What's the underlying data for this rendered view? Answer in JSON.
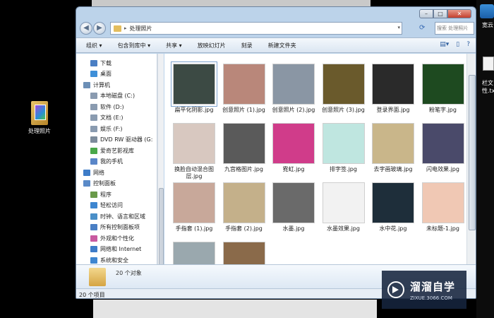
{
  "desktop": {
    "icon_label": "处理照片",
    "edge_labels": [
      "宽云",
      "栏文",
      "性.tx"
    ]
  },
  "window": {
    "address": {
      "folder_name": "处理照片",
      "separator": "▸"
    },
    "search_placeholder": "搜索 处理照片",
    "toolbar": [
      "组织 ▾",
      "包含到库中 ▾",
      "共享 ▾",
      "放映幻灯片",
      "刻录",
      "新建文件夹"
    ],
    "nav_items": [
      {
        "label": "下载",
        "color": "#4a7fc4",
        "indent": 2
      },
      {
        "label": "桌面",
        "color": "#3e8fd8",
        "indent": 2
      },
      {
        "label": "计算机",
        "color": "#6c8fb6",
        "indent": 1
      },
      {
        "label": "本地磁盘 (C:)",
        "color": "#8a9bb0",
        "indent": 2
      },
      {
        "label": "软件 (D:)",
        "color": "#8a9bb0",
        "indent": 2
      },
      {
        "label": "文档 (E:)",
        "color": "#8a9bb0",
        "indent": 2
      },
      {
        "label": "娱乐 (F:)",
        "color": "#8a9bb0",
        "indent": 2
      },
      {
        "label": "DVD RW 驱动器 (G:",
        "color": "#7d8c9c",
        "indent": 2
      },
      {
        "label": "爱奇艺影视库",
        "color": "#4aa84a",
        "indent": 2
      },
      {
        "label": "我的手机",
        "color": "#5a86c8",
        "indent": 2
      },
      {
        "label": "网络",
        "color": "#3e7cc8",
        "indent": 1
      },
      {
        "label": "控制面板",
        "color": "#5a8ac8",
        "indent": 1
      },
      {
        "label": "程序",
        "color": "#6a9a4a",
        "indent": 2
      },
      {
        "label": "轻松访问",
        "color": "#3e86d0",
        "indent": 2
      },
      {
        "label": "时钟、语言和区域",
        "color": "#4a8fc8",
        "indent": 2
      },
      {
        "label": "所有控制面板项",
        "color": "#4a7fc4",
        "indent": 2
      },
      {
        "label": "外观和个性化",
        "color": "#c85aa0",
        "indent": 2
      },
      {
        "label": "网络和 Internet",
        "color": "#3e7cc8",
        "indent": 2
      },
      {
        "label": "系统和安全",
        "color": "#3e86d0",
        "indent": 2
      }
    ],
    "files": [
      {
        "name": "扁平化阴影.jpg",
        "bg": "#3c4a44",
        "selected": true
      },
      {
        "name": "创意照片 (1).jpg",
        "bg": "#b9877a"
      },
      {
        "name": "创意照片 (2).jpg",
        "bg": "#8a96a4"
      },
      {
        "name": "创意照片 (3).jpg",
        "bg": "#6a5a2c"
      },
      {
        "name": "登录界面.jpg",
        "bg": "#2a2a2a"
      },
      {
        "name": "粉笔字.jpg",
        "bg": "#1e4a20"
      },
      {
        "name": "换脸自动混合图层.jpg",
        "bg": "#d8c8c0"
      },
      {
        "name": "九宫格图片.jpg",
        "bg": "#5a5a5a"
      },
      {
        "name": "霓虹.jpg",
        "bg": "#d03c8a"
      },
      {
        "name": "排字签.jpg",
        "bg": "#bfe6e0"
      },
      {
        "name": "去字画玻璃.jpg",
        "bg": "#c9b68a"
      },
      {
        "name": "闪电效果.jpg",
        "bg": "#4a4a6a"
      },
      {
        "name": "手指套 (1).jpg",
        "bg": "#c8a89a"
      },
      {
        "name": "手指套 (2).jpg",
        "bg": "#c4b08a"
      },
      {
        "name": "水墨.jpg",
        "bg": "#6a6a6a"
      },
      {
        "name": "水墨效果.jpg",
        "bg": "#f2f2f2"
      },
      {
        "name": "水中花.jpg",
        "bg": "#1e2e3a"
      },
      {
        "name": "未标题-1.jpg",
        "bg": "#f0c8b4"
      },
      {
        "name": "",
        "bg": "#9aa8ae"
      },
      {
        "name": "",
        "bg": "#8a6a4a"
      }
    ],
    "details_text": "20 个对象",
    "status_text": "20 个项目"
  },
  "watermark": {
    "title": "溜溜自学",
    "url": "ZIXUE.3066.COM"
  }
}
